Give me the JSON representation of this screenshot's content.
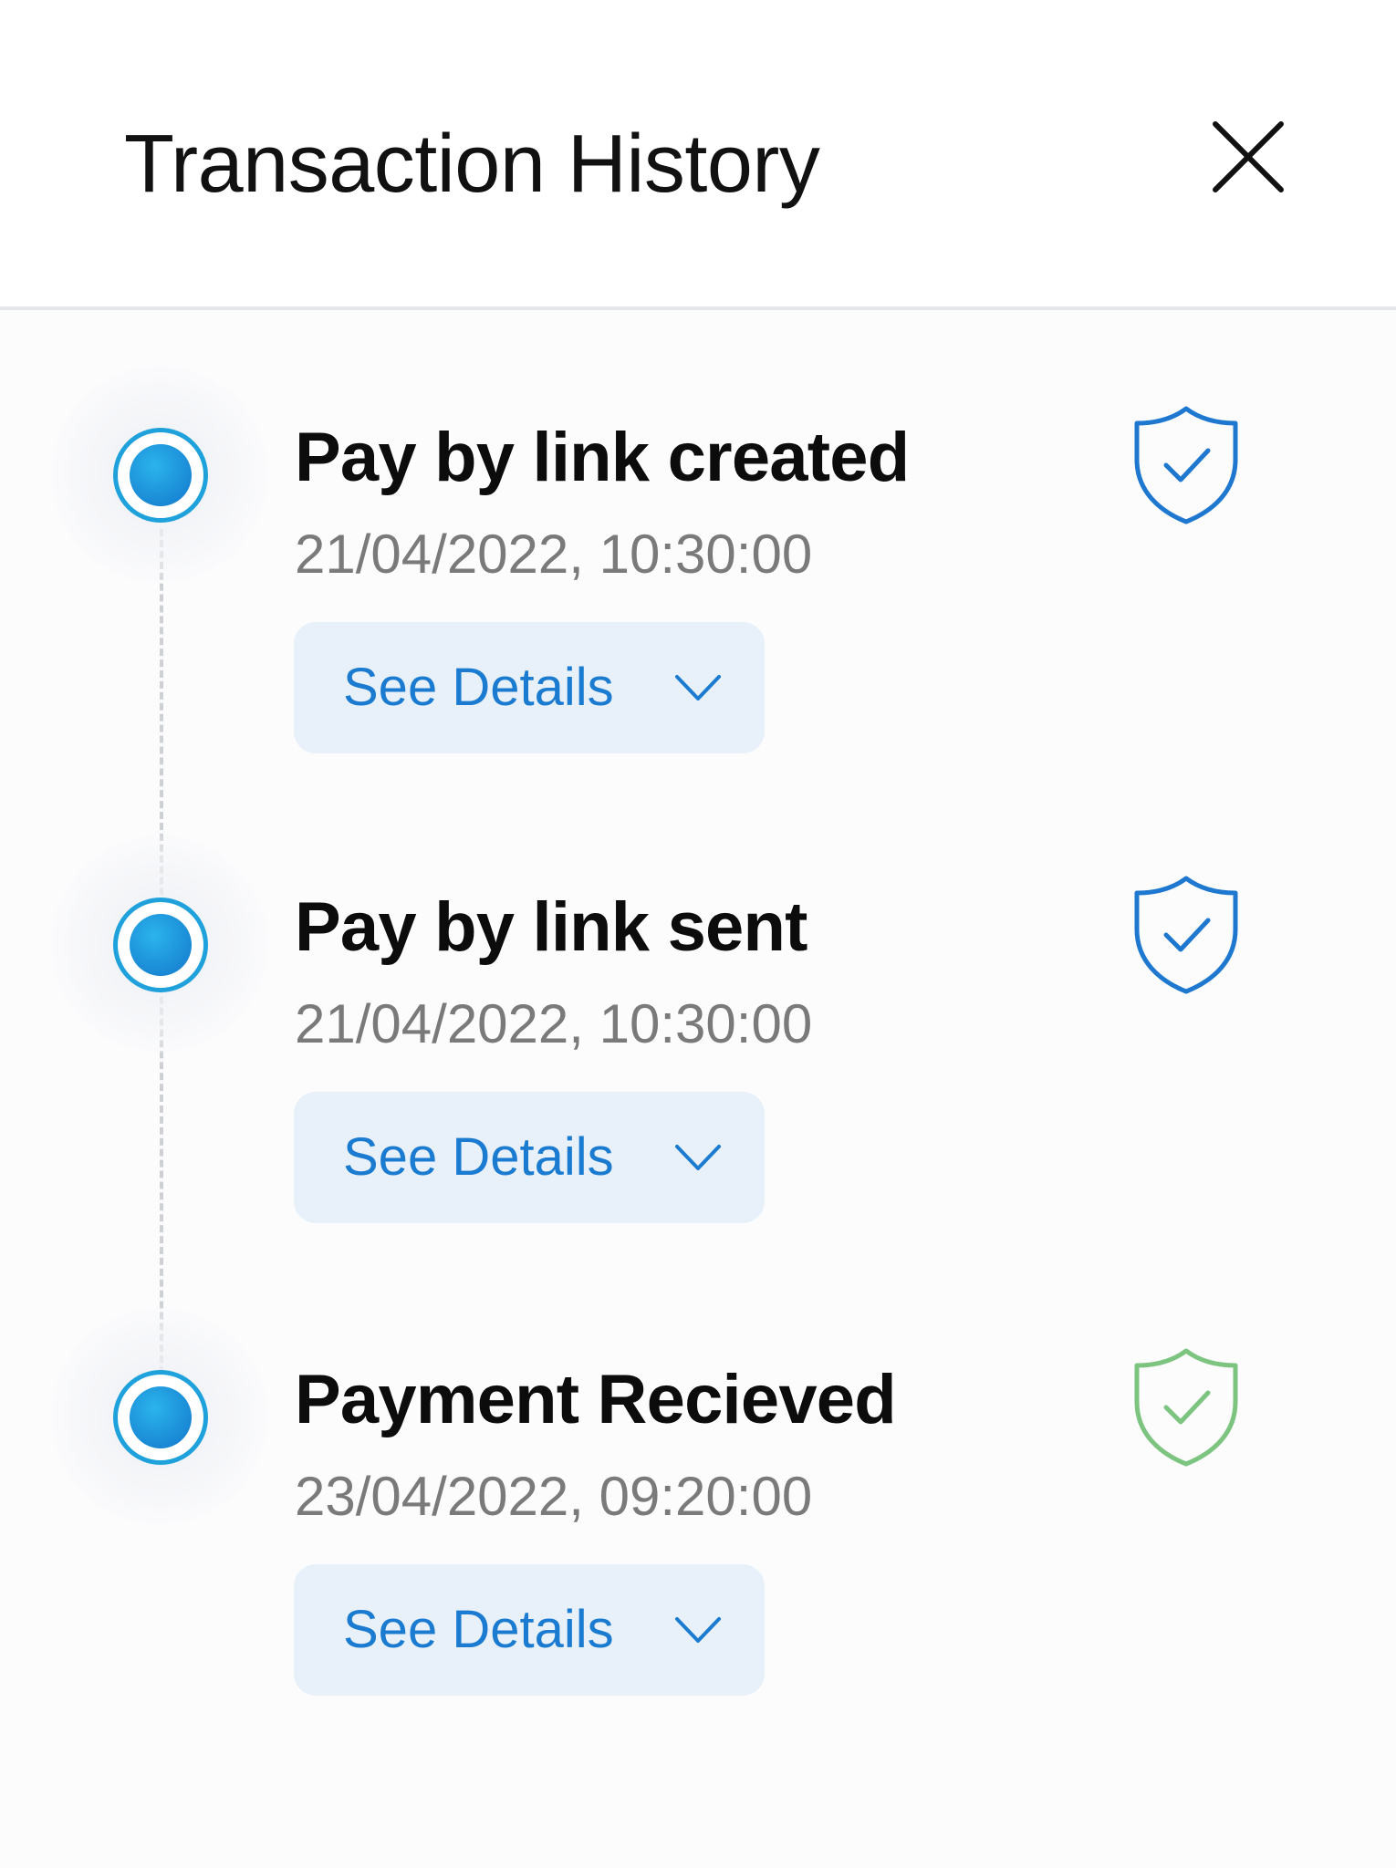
{
  "header": {
    "title": "Transaction History",
    "close_icon": "close-icon"
  },
  "colors": {
    "title_text": "#111111",
    "time_text": "#7a7a7a",
    "details_text": "#1a7bd0",
    "details_bg": "#e8f1f9",
    "dot_ring": "#1fa1dc",
    "shield_blue": "#1f78cf",
    "shield_green": "#7cc480",
    "divider": "#e4e6ea"
  },
  "events": [
    {
      "title": "Pay by link created",
      "timestamp": "21/04/2022, 10:30:00",
      "details_label": "See Details",
      "status_icon": "shield-check-icon",
      "status_color": "#1f78cf"
    },
    {
      "title": "Pay by link sent",
      "timestamp": "21/04/2022, 10:30:00",
      "details_label": "See Details",
      "status_icon": "shield-check-icon",
      "status_color": "#1f78cf"
    },
    {
      "title": "Payment Recieved",
      "timestamp": "23/04/2022, 09:20:00",
      "details_label": "See Details",
      "status_icon": "shield-check-icon",
      "status_color": "#7cc480"
    }
  ]
}
